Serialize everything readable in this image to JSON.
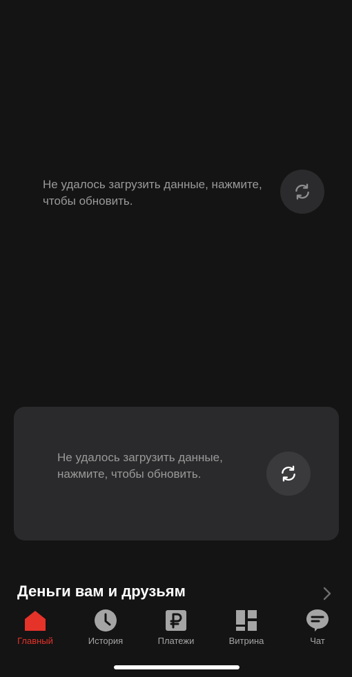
{
  "top_error": {
    "message": "Не удалось загрузить данные, нажмите, чтобы обновить."
  },
  "card_error": {
    "message": "Не удалось загрузить данные, нажмите, чтобы обновить."
  },
  "section": {
    "title": "Деньги вам и друзьям"
  },
  "tabbar": {
    "items": [
      {
        "label": "Главный",
        "icon": "home-icon",
        "active": true
      },
      {
        "label": "История",
        "icon": "clock-icon",
        "active": false
      },
      {
        "label": "Платежи",
        "icon": "ruble-icon",
        "active": false
      },
      {
        "label": "Витрина",
        "icon": "showcase-icon",
        "active": false
      },
      {
        "label": "Чат",
        "icon": "chat-icon",
        "active": false
      }
    ]
  },
  "colors": {
    "background": "#141414",
    "card": "#2a2a2c",
    "accent": "#e5332a",
    "muted_text": "#9a9a9a"
  }
}
